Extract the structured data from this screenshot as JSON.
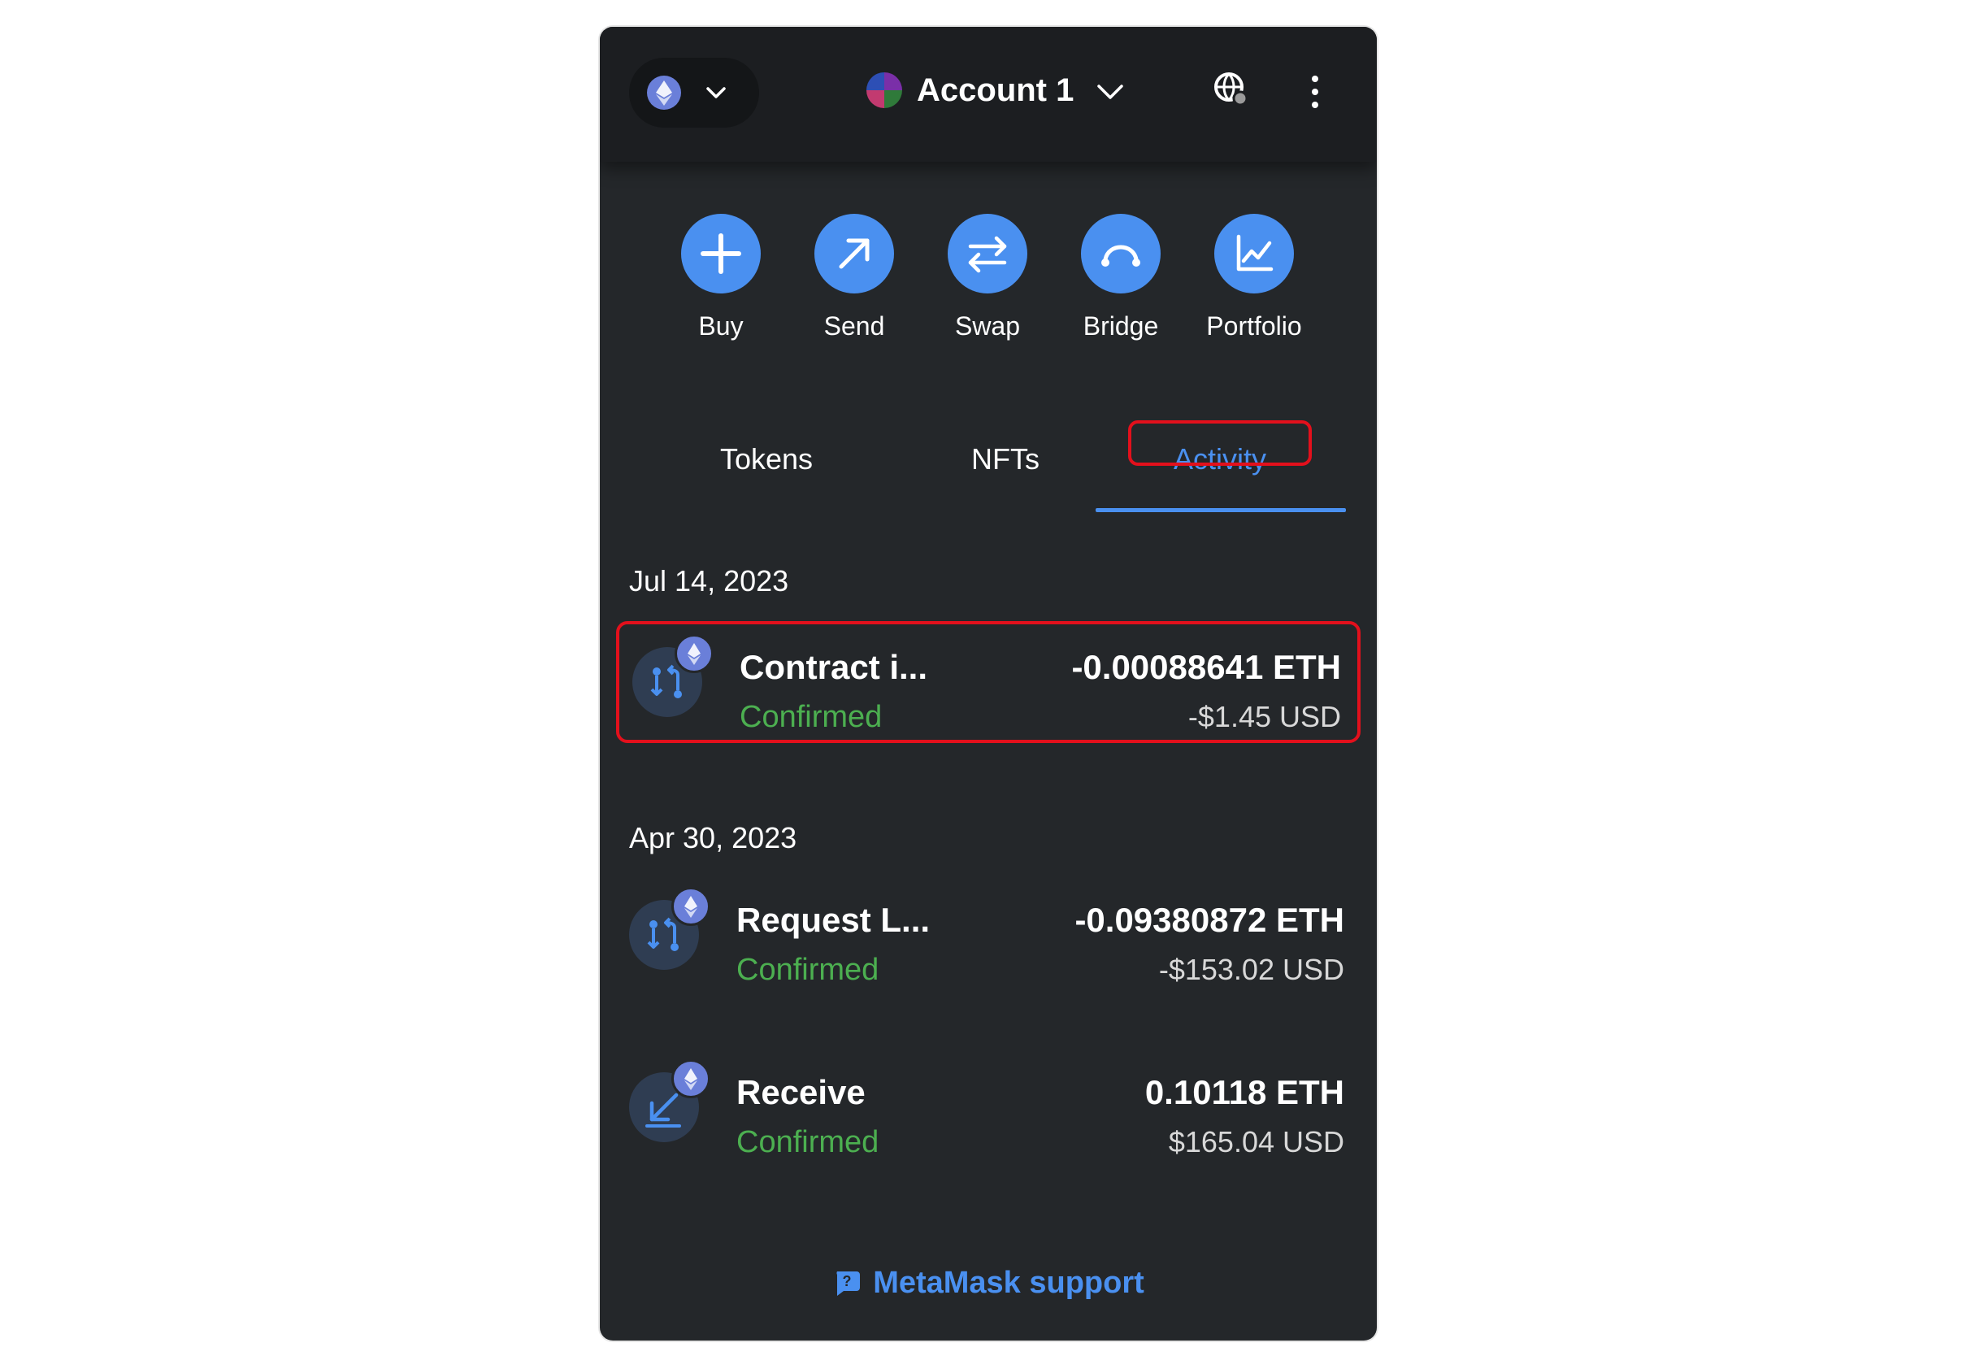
{
  "header": {
    "account_name": "Account 1",
    "network_icon": "ethereum-icon"
  },
  "actions": [
    {
      "label": "Buy",
      "icon": "plus-icon"
    },
    {
      "label": "Send",
      "icon": "arrow-up-right-icon"
    },
    {
      "label": "Swap",
      "icon": "swap-arrows-icon"
    },
    {
      "label": "Bridge",
      "icon": "bridge-icon"
    },
    {
      "label": "Portfolio",
      "icon": "chart-line-icon"
    }
  ],
  "tabs": [
    {
      "label": "Tokens",
      "active": false
    },
    {
      "label": "NFTs",
      "active": false
    },
    {
      "label": "Activity",
      "active": true
    }
  ],
  "activity": {
    "groups": [
      {
        "date": "Jul 14, 2023",
        "items": [
          {
            "title": "Contract i...",
            "status": "Confirmed",
            "amount": "-0.00088641 ETH",
            "usd": "-$1.45 USD",
            "icon": "contract-interaction-icon"
          }
        ]
      },
      {
        "date": "Apr 30, 2023",
        "items": [
          {
            "title": "Request L...",
            "status": "Confirmed",
            "amount": "-0.09380872 ETH",
            "usd": "-$153.02 USD",
            "icon": "contract-interaction-icon"
          },
          {
            "title": "Receive",
            "status": "Confirmed",
            "amount": "0.10118 ETH",
            "usd": "$165.04 USD",
            "icon": "receive-arrow-icon"
          }
        ]
      }
    ]
  },
  "footer": {
    "support_label": "MetaMask support"
  },
  "colors": {
    "accent": "#4a90f0",
    "success": "#4caf50",
    "highlight": "#e3101c",
    "panel_bg": "#24272a"
  }
}
